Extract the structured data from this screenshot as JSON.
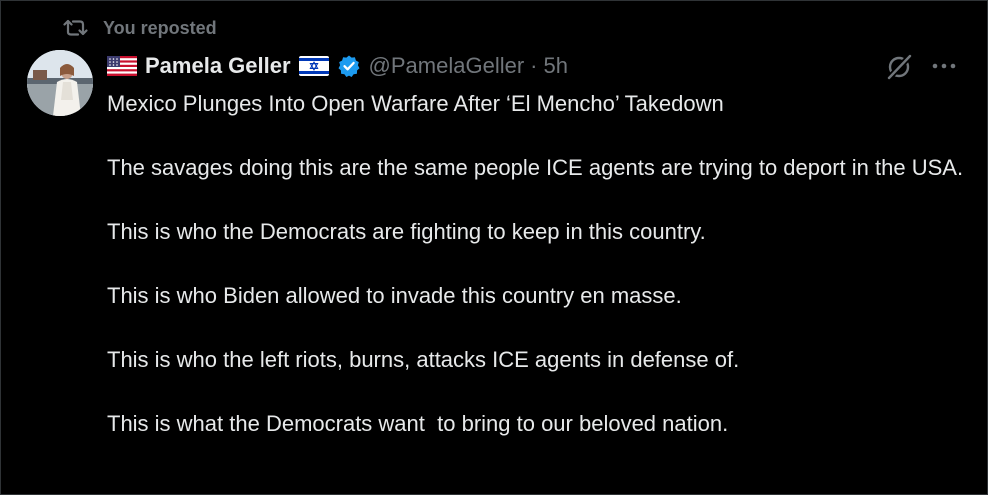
{
  "repost": {
    "label": "You reposted"
  },
  "author": {
    "name": "Pamela Geller",
    "handle": "@PamelaGeller",
    "separator": "·",
    "time": "5h",
    "flags": [
      "us-flag-icon",
      "israel-flag-icon"
    ],
    "verified_icon": "verified-badge-icon"
  },
  "tweet": {
    "paragraphs": [
      "Mexico Plunges Into Open Warfare After ‘El Mencho’ Takedown",
      "The savages doing this are the same people ICE agents are trying to deport in the USA.",
      "This is who the Democrats are fighting to keep in this country.",
      "This is who Biden allowed to invade this country en masse.",
      "This is who the left riots, burns, attacks ICE agents in defense of.",
      "This is what the Democrats want  to bring to our beloved nation."
    ]
  },
  "icons": {
    "repost": "repost-icon",
    "grok": "grok-icon",
    "more": "more-icon"
  },
  "colors": {
    "background": "#000000",
    "text": "#e7e9ea",
    "secondary": "#71767b",
    "verified": "#1d9bf0",
    "border": "#2f3336"
  }
}
